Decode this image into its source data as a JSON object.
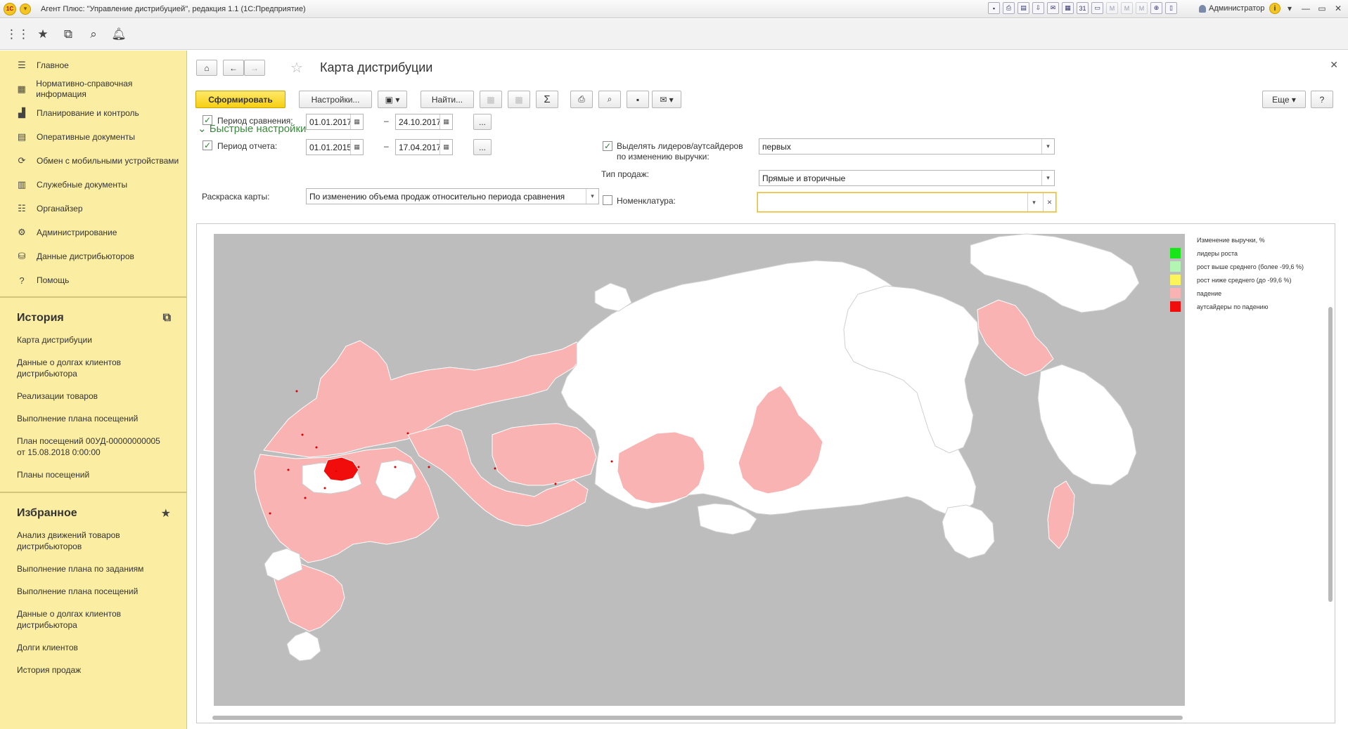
{
  "window": {
    "title": "Агент Плюс: \"Управление дистрибуцией\", редакция 1.1  (1С:Предприятие)",
    "user": "Администратор"
  },
  "sidebar": {
    "nav": [
      {
        "label": "Главное",
        "icon": "menu-lines-icon"
      },
      {
        "label": "Нормативно-справочная информация",
        "icon": "catalog-icon"
      },
      {
        "label": "Планирование и контроль",
        "icon": "chart-icon"
      },
      {
        "label": "Оперативные документы",
        "icon": "documents-icon"
      },
      {
        "label": "Обмен с мобильными устройствами",
        "icon": "sync-icon"
      },
      {
        "label": "Служебные документы",
        "icon": "service-docs-icon"
      },
      {
        "label": "Органайзер",
        "icon": "organizer-icon"
      },
      {
        "label": "Администрирование",
        "icon": "gear-icon"
      },
      {
        "label": "Данные дистрибьюторов",
        "icon": "distributor-data-icon"
      },
      {
        "label": "Помощь",
        "icon": "help-icon"
      }
    ],
    "history": {
      "title": "История",
      "items": [
        "Карта дистрибуции",
        "Данные о долгах клиентов дистрибьютора",
        "Реализации товаров",
        "Выполнение плана посещений",
        "План посещений 00УД-00000000005 от 15.08.2018 0:00:00",
        "Планы посещений"
      ]
    },
    "favorites": {
      "title": "Избранное",
      "items": [
        "Анализ движений товаров дистрибьюторов",
        "Выполнение плана по заданиям",
        "Выполнение плана посещений",
        "Данные о долгах клиентов дистрибьютора",
        "Долги клиентов",
        "История продаж"
      ]
    }
  },
  "form": {
    "title": "Карта дистрибуции",
    "buttons": {
      "generate": "Сформировать",
      "settings": "Настройки...",
      "find": "Найти...",
      "more": "Еще",
      "help": "?"
    },
    "quick_settings": "Быстрые настройки",
    "period_compare": {
      "label": "Период сравнения:",
      "from": "01.01.2017",
      "to": "24.10.2017",
      "checked": true
    },
    "period_report": {
      "label": "Период отчета:",
      "from": "01.01.2015",
      "to": "17.04.2017",
      "checked": true
    },
    "dash": "–",
    "ellipsis": "...",
    "coloring": {
      "label": "Раскраска карты:",
      "value": "По изменению объема продаж относительно периода сравнения"
    },
    "leaders": {
      "label_line1": "Выделять лидеров/аутсайдеров",
      "label_line2": "по изменению выручки:",
      "value": "первых",
      "checked": true
    },
    "sales_type": {
      "label": "Тип продаж:",
      "value": "Прямые и вторичные"
    },
    "nomenclature": {
      "label": "Номенклатура:",
      "value": "",
      "checked": false
    }
  },
  "legend": {
    "title": "Изменение выручки, %",
    "items": [
      {
        "label": "лидеры роста",
        "color": "#19e619"
      },
      {
        "label": "рост выше среднего (более -99,6 %)",
        "color": "#b3f5b3"
      },
      {
        "label": "рост ниже среднего (до -99,6 %)",
        "color": "#fbf55a"
      },
      {
        "label": "падение",
        "color": "#f9b3b3"
      },
      {
        "label": "аутсайдеры по падению",
        "color": "#f20d0d"
      }
    ]
  },
  "colors": {
    "map_background": "#bdbdbd",
    "region_neutral": "#ffffff",
    "region_decline": "#f9b3b3",
    "region_outsider": "#f20d0d",
    "accent_yellow": "#fbeea3"
  }
}
